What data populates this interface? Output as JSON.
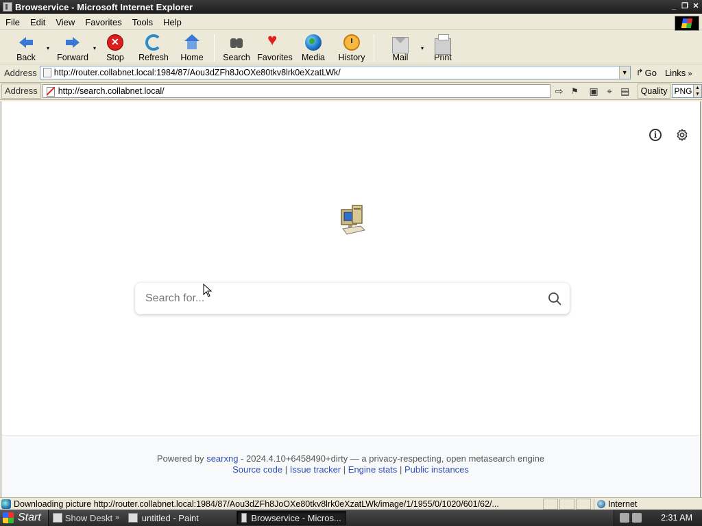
{
  "window": {
    "title": "Browservice - Microsoft Internet Explorer",
    "minimize": "_",
    "restore": "❐",
    "close": "✕"
  },
  "menubar": {
    "items": [
      "File",
      "Edit",
      "View",
      "Favorites",
      "Tools",
      "Help"
    ]
  },
  "toolbar": {
    "back": "Back",
    "forward": "Forward",
    "stop": "Stop",
    "refresh": "Refresh",
    "home": "Home",
    "search": "Search",
    "favorites": "Favorites",
    "media": "Media",
    "history": "History",
    "mail": "Mail",
    "print": "Print",
    "caret": "▾"
  },
  "address_bar": {
    "label": "Address",
    "url": "http://router.collabnet.local:1984/87/Aou3dZFh8JoOXe80tkv8lrk0eXzatLWk/",
    "dropdown": "▼",
    "go": "Go",
    "go_arrow": "↱",
    "links": "Links",
    "links_chevron": "»"
  },
  "inner_bar": {
    "label": "Address",
    "url": "http://search.collabnet.local/",
    "quality_label": "Quality",
    "quality_value": "PNG",
    "btn_go": "⇨",
    "btn_bookmark": "🔖",
    "btn_find": "▣",
    "btn_binoculars": "⌖",
    "btn_clipboard": "▤"
  },
  "page": {
    "search_placeholder": "Search for...",
    "footer": {
      "powered_by": "Powered by",
      "engine_link": "searxng",
      "version_text": "- 2024.4.10+6458490+dirty — a privacy-respecting, open metasearch engine",
      "links": [
        "Source code",
        "Issue tracker",
        "Engine stats",
        "Public instances"
      ],
      "separator": "|"
    }
  },
  "statusbar": {
    "text": "Downloading picture http://router.collabnet.local:1984/87/Aou3dZFh8JoOXe80tkv8lrk0eXzatLWk/image/1/1955/0/1020/601/62/...",
    "zone": "Internet"
  },
  "taskbar": {
    "start": "Start",
    "quick_launch": "Show Deskt",
    "quick_more": "»",
    "tasks": [
      "untitled - Paint",
      "Browservice - Micros..."
    ],
    "clock": "2:31 AM"
  },
  "colors": {
    "link": "#3050b8",
    "footer_bg": "#f8f9fa",
    "chrome_bg": "#ece9d8"
  }
}
